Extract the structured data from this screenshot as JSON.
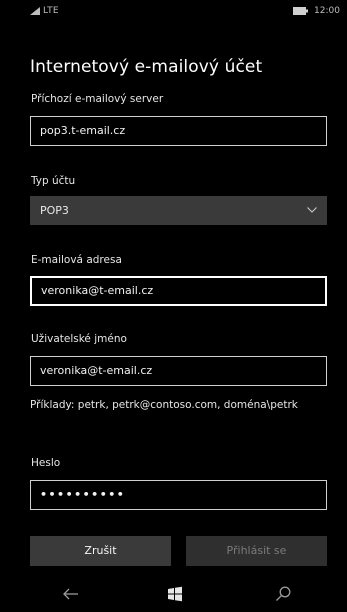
{
  "status_bar": {
    "network": "LTE",
    "time": "12:00",
    "icons": [
      "signal-icon",
      "battery-icon"
    ]
  },
  "page": {
    "title": "Internetový e-mailový účet"
  },
  "incoming_server": {
    "label": "Příchozí e-mailový server",
    "value": "pop3.t-email.cz"
  },
  "account_type": {
    "label": "Typ účtu",
    "selected": "POP3",
    "icon": "chevron-down-icon"
  },
  "email": {
    "label": "E-mailová adresa",
    "value": "veronika@t-email.cz"
  },
  "username": {
    "label": "Uživatelské jméno",
    "value": "veronika@t-email.cz",
    "hint": "Příklady: petrk, petrk@contoso.com, doména\\petrk"
  },
  "password": {
    "label": "Heslo",
    "masked_value": "••••••••••"
  },
  "buttons": {
    "cancel": "Zrušit",
    "sign_in": "Přihlásit se"
  },
  "nav": {
    "icons": [
      "back-icon",
      "windows-icon",
      "search-icon"
    ]
  },
  "colors": {
    "background": "#000000",
    "button_bg": "#3a3a3a",
    "disabled_text": "#7b7b7b",
    "field_border": "#cfcfcf"
  }
}
